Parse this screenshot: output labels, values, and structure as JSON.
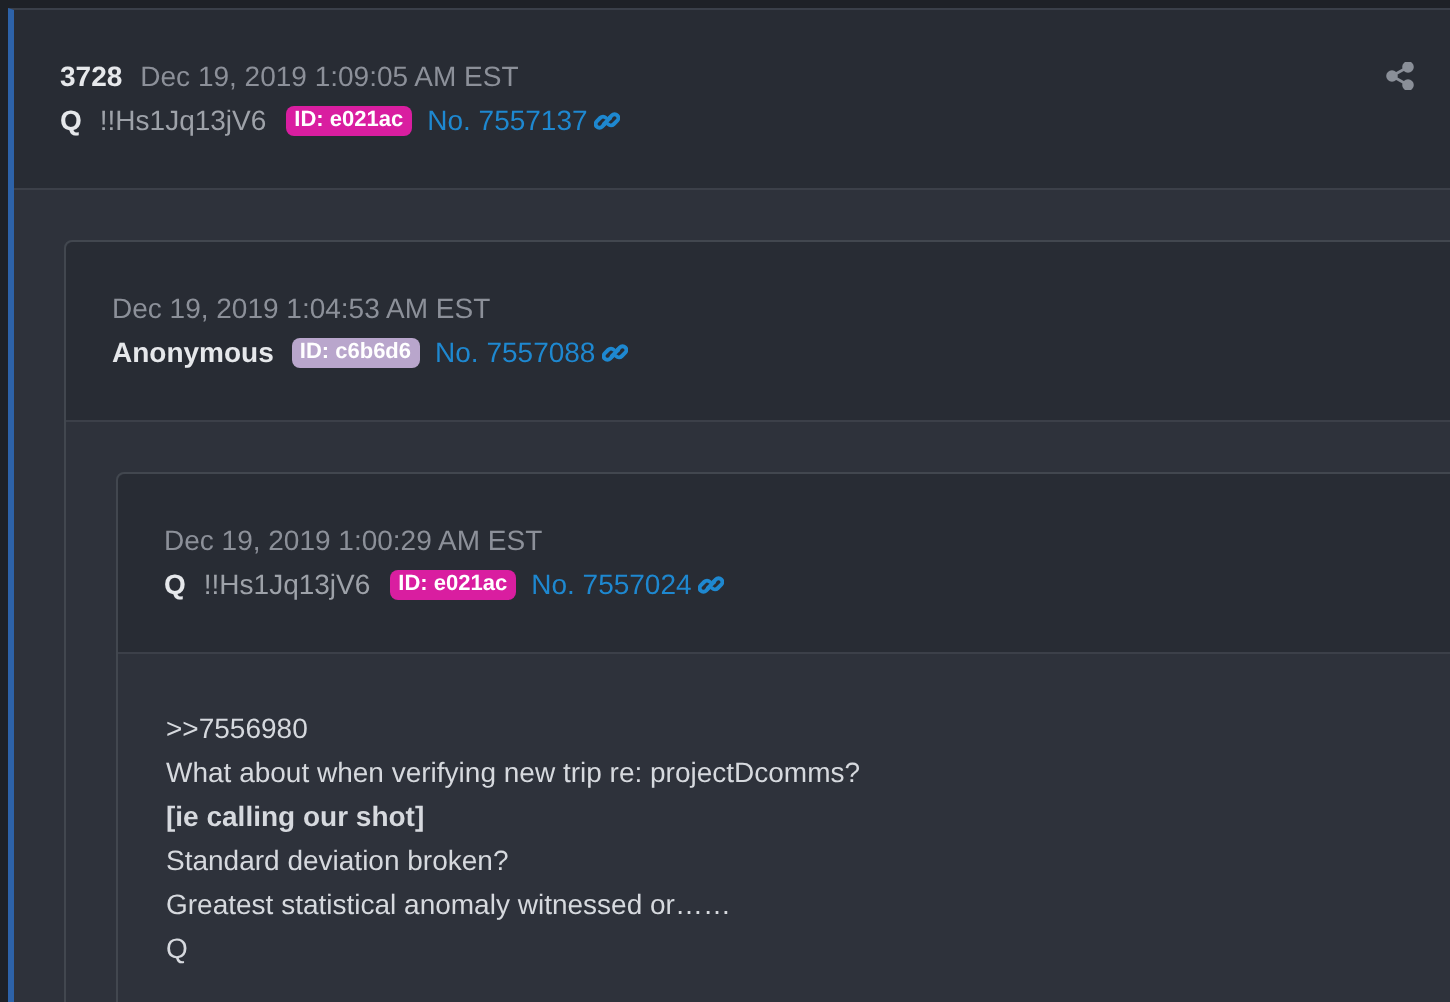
{
  "post": {
    "number": "3728",
    "date": "Dec 19, 2019 1:09:05 AM EST",
    "name": "Q",
    "tripcode": "!!Hs1Jq13jV6",
    "id": {
      "label": "ID: e021ac",
      "color": "#d91ea0"
    },
    "post_no": "No. 7557137",
    "quoted": {
      "date": "Dec 19, 2019 1:04:53 AM EST",
      "name": "Anonymous",
      "id": {
        "label": "ID: c6b6d6",
        "color": "#b9a6cc"
      },
      "post_no": "No. 7557088",
      "quoted": {
        "date": "Dec 19, 2019 1:00:29 AM EST",
        "name": "Q",
        "tripcode": "!!Hs1Jq13jV6",
        "id": {
          "label": "ID: e021ac",
          "color": "#d91ea0"
        },
        "post_no": "No. 7557024",
        "lines": [
          {
            "text": ">>7556980",
            "kind": "plain"
          },
          {
            "text": "What about when verifying new trip re: projectDcomms?",
            "kind": "plain"
          },
          {
            "text": "[ie calling our shot]",
            "kind": "bold"
          },
          {
            "text": "Standard deviation broken?",
            "kind": "plain"
          },
          {
            "text": "Greatest statistical anomaly witnessed or……",
            "kind": "plain"
          },
          {
            "text": "Q",
            "kind": "plain"
          }
        ]
      }
    }
  }
}
